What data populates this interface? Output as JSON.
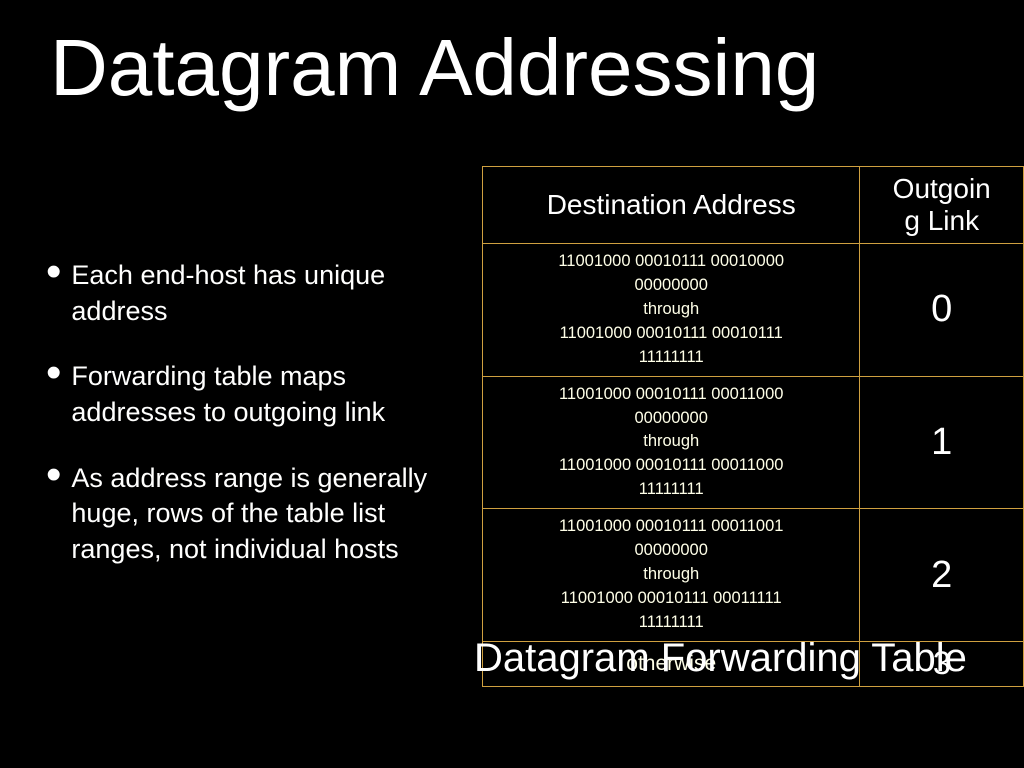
{
  "title": "Datagram Addressing",
  "bullets": [
    "Each end-host has unique address",
    "Forwarding table maps addresses to outgoing link",
    "As address range is generally huge, rows of the table list ranges, not individual hosts"
  ],
  "table": {
    "headers": {
      "dest": "Destination Address",
      "link": "Outgoin\ng Link"
    },
    "rows": [
      {
        "dest_lines": [
          "11001000 00010111 00010000",
          "00000000",
          "through",
          "11001000 00010111 00010111",
          "11111111"
        ],
        "link": "0"
      },
      {
        "dest_lines": [
          "11001000 00010111 00011000",
          "00000000",
          "through",
          "11001000 00010111 00011000",
          "11111111"
        ],
        "link": "1"
      },
      {
        "dest_lines": [
          "11001000 00010111 00011001",
          "00000000",
          "through",
          "11001000 00010111 00011111",
          "11111111"
        ],
        "link": "2"
      },
      {
        "dest_lines": [
          "otherwise"
        ],
        "link": "3"
      }
    ],
    "caption": "Datagram Forwarding Table"
  }
}
